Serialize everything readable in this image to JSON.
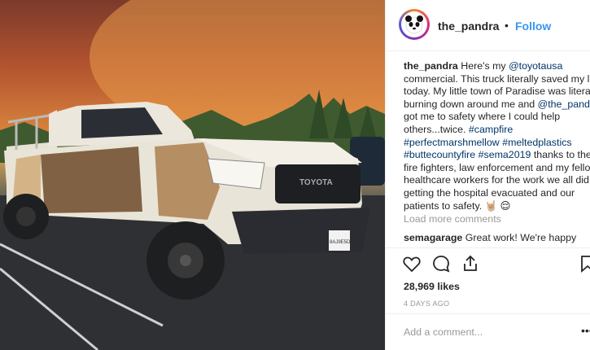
{
  "post": {
    "username": "the_pandra",
    "follow_label": "Follow",
    "caption_lines": [
      [
        {
          "t": "the_pandra",
          "b": true
        },
        {
          "t": " Here's my "
        },
        {
          "t": "@toyotausa",
          "l": true
        }
      ],
      [
        {
          "t": "commercial. This truck literally saved my life"
        }
      ],
      [
        {
          "t": "today. My little town of Paradise was literally"
        }
      ],
      [
        {
          "t": "burning down around me and "
        },
        {
          "t": "@the_pandra",
          "l": true
        }
      ],
      [
        {
          "t": "got me to safety where I could help"
        }
      ],
      [
        {
          "t": "others...twice. "
        },
        {
          "t": "#campfire",
          "l": true
        }
      ],
      [
        {
          "t": "#perfectmarshmellow #meltedplastics",
          "l": true
        }
      ],
      [
        {
          "t": "#buttecountyfire #sema2019",
          "l": true
        },
        {
          "t": " thanks to the"
        }
      ],
      [
        {
          "t": "fire fighters, law enforcement and my fellow"
        }
      ],
      [
        {
          "t": "healthcare workers for the work we all did"
        }
      ],
      [
        {
          "t": "getting the hospital evacuated and our"
        }
      ],
      [
        {
          "t": "patients to safety. 🤘🏼 😌"
        }
      ]
    ],
    "load_more": "Load more comments",
    "comment": {
      "user": "semagarage",
      "text": " Great work! We're happy"
    },
    "likes": "28,969 likes",
    "time": "4 DAYS AGO",
    "add_comment_placeholder": "Add a comment...",
    "more_options": "•••",
    "license_plate": "8AJ9E5D",
    "grille_text": "TOYOTA"
  }
}
